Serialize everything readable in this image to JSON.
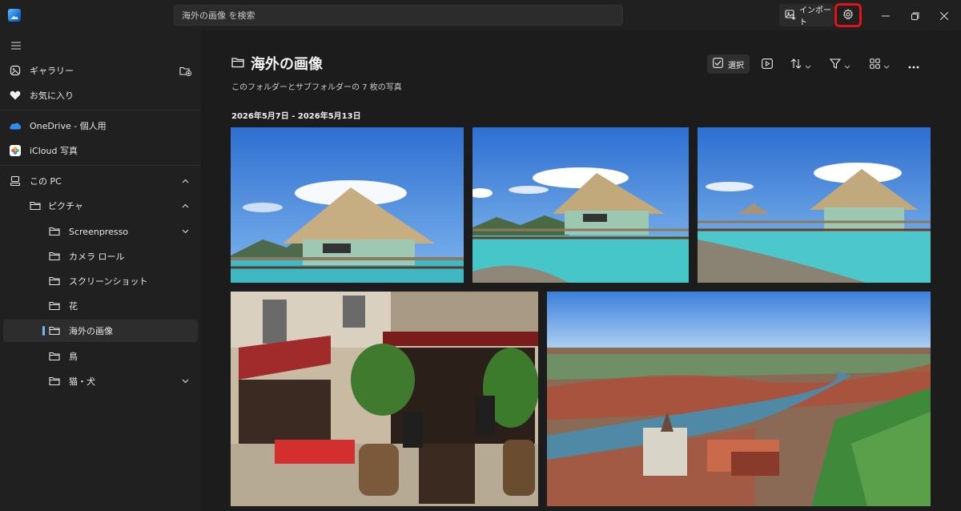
{
  "search": {
    "placeholder": "海外の画像 を検索"
  },
  "header": {
    "import_label": "インポート"
  },
  "sidebar": {
    "gallery": "ギャラリー",
    "favorites": "お気に入り",
    "onedrive": "OneDrive - 個人用",
    "icloud": "iCloud 写真",
    "this_pc": "この PC",
    "pictures": "ピクチャ",
    "folders": [
      "Screenpresso",
      "カメラ ロール",
      "スクリーンショット",
      "花",
      "海外の画像",
      "鳥",
      "猫・犬"
    ]
  },
  "main": {
    "title": "海外の画像",
    "subtitle": "このフォルダーとサブフォルダーの 7 枚の写真",
    "date_range": "2026年5月7日 - 2026年5月13日",
    "select_label": "選択"
  },
  "colors": {
    "accent": "#6cb8f6",
    "highlight": "#e3131b",
    "background": "#1c1c1c",
    "sidebar": "#202020"
  }
}
